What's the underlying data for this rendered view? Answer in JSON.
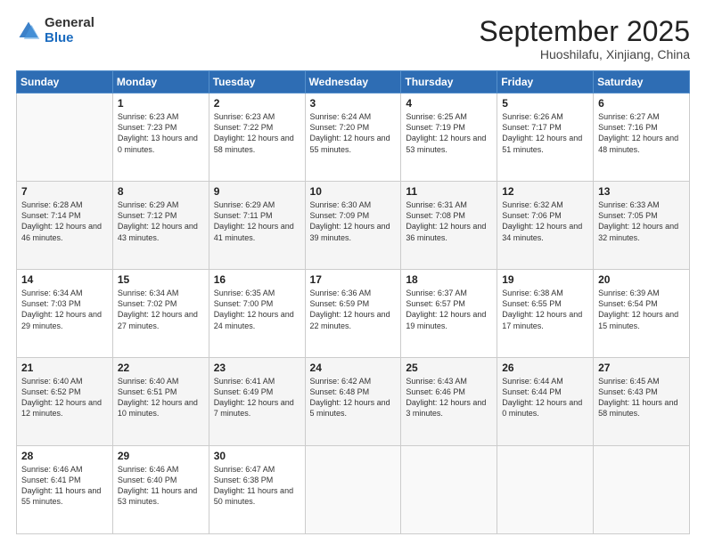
{
  "logo": {
    "general": "General",
    "blue": "Blue"
  },
  "header": {
    "month": "September 2025",
    "location": "Huoshilafu, Xinjiang, China"
  },
  "days": [
    "Sunday",
    "Monday",
    "Tuesday",
    "Wednesday",
    "Thursday",
    "Friday",
    "Saturday"
  ],
  "weeks": [
    [
      {
        "day": "",
        "sunrise": "",
        "sunset": "",
        "daylight": ""
      },
      {
        "day": "1",
        "sunrise": "Sunrise: 6:23 AM",
        "sunset": "Sunset: 7:23 PM",
        "daylight": "Daylight: 13 hours and 0 minutes."
      },
      {
        "day": "2",
        "sunrise": "Sunrise: 6:23 AM",
        "sunset": "Sunset: 7:22 PM",
        "daylight": "Daylight: 12 hours and 58 minutes."
      },
      {
        "day": "3",
        "sunrise": "Sunrise: 6:24 AM",
        "sunset": "Sunset: 7:20 PM",
        "daylight": "Daylight: 12 hours and 55 minutes."
      },
      {
        "day": "4",
        "sunrise": "Sunrise: 6:25 AM",
        "sunset": "Sunset: 7:19 PM",
        "daylight": "Daylight: 12 hours and 53 minutes."
      },
      {
        "day": "5",
        "sunrise": "Sunrise: 6:26 AM",
        "sunset": "Sunset: 7:17 PM",
        "daylight": "Daylight: 12 hours and 51 minutes."
      },
      {
        "day": "6",
        "sunrise": "Sunrise: 6:27 AM",
        "sunset": "Sunset: 7:16 PM",
        "daylight": "Daylight: 12 hours and 48 minutes."
      }
    ],
    [
      {
        "day": "7",
        "sunrise": "Sunrise: 6:28 AM",
        "sunset": "Sunset: 7:14 PM",
        "daylight": "Daylight: 12 hours and 46 minutes."
      },
      {
        "day": "8",
        "sunrise": "Sunrise: 6:29 AM",
        "sunset": "Sunset: 7:12 PM",
        "daylight": "Daylight: 12 hours and 43 minutes."
      },
      {
        "day": "9",
        "sunrise": "Sunrise: 6:29 AM",
        "sunset": "Sunset: 7:11 PM",
        "daylight": "Daylight: 12 hours and 41 minutes."
      },
      {
        "day": "10",
        "sunrise": "Sunrise: 6:30 AM",
        "sunset": "Sunset: 7:09 PM",
        "daylight": "Daylight: 12 hours and 39 minutes."
      },
      {
        "day": "11",
        "sunrise": "Sunrise: 6:31 AM",
        "sunset": "Sunset: 7:08 PM",
        "daylight": "Daylight: 12 hours and 36 minutes."
      },
      {
        "day": "12",
        "sunrise": "Sunrise: 6:32 AM",
        "sunset": "Sunset: 7:06 PM",
        "daylight": "Daylight: 12 hours and 34 minutes."
      },
      {
        "day": "13",
        "sunrise": "Sunrise: 6:33 AM",
        "sunset": "Sunset: 7:05 PM",
        "daylight": "Daylight: 12 hours and 32 minutes."
      }
    ],
    [
      {
        "day": "14",
        "sunrise": "Sunrise: 6:34 AM",
        "sunset": "Sunset: 7:03 PM",
        "daylight": "Daylight: 12 hours and 29 minutes."
      },
      {
        "day": "15",
        "sunrise": "Sunrise: 6:34 AM",
        "sunset": "Sunset: 7:02 PM",
        "daylight": "Daylight: 12 hours and 27 minutes."
      },
      {
        "day": "16",
        "sunrise": "Sunrise: 6:35 AM",
        "sunset": "Sunset: 7:00 PM",
        "daylight": "Daylight: 12 hours and 24 minutes."
      },
      {
        "day": "17",
        "sunrise": "Sunrise: 6:36 AM",
        "sunset": "Sunset: 6:59 PM",
        "daylight": "Daylight: 12 hours and 22 minutes."
      },
      {
        "day": "18",
        "sunrise": "Sunrise: 6:37 AM",
        "sunset": "Sunset: 6:57 PM",
        "daylight": "Daylight: 12 hours and 19 minutes."
      },
      {
        "day": "19",
        "sunrise": "Sunrise: 6:38 AM",
        "sunset": "Sunset: 6:55 PM",
        "daylight": "Daylight: 12 hours and 17 minutes."
      },
      {
        "day": "20",
        "sunrise": "Sunrise: 6:39 AM",
        "sunset": "Sunset: 6:54 PM",
        "daylight": "Daylight: 12 hours and 15 minutes."
      }
    ],
    [
      {
        "day": "21",
        "sunrise": "Sunrise: 6:40 AM",
        "sunset": "Sunset: 6:52 PM",
        "daylight": "Daylight: 12 hours and 12 minutes."
      },
      {
        "day": "22",
        "sunrise": "Sunrise: 6:40 AM",
        "sunset": "Sunset: 6:51 PM",
        "daylight": "Daylight: 12 hours and 10 minutes."
      },
      {
        "day": "23",
        "sunrise": "Sunrise: 6:41 AM",
        "sunset": "Sunset: 6:49 PM",
        "daylight": "Daylight: 12 hours and 7 minutes."
      },
      {
        "day": "24",
        "sunrise": "Sunrise: 6:42 AM",
        "sunset": "Sunset: 6:48 PM",
        "daylight": "Daylight: 12 hours and 5 minutes."
      },
      {
        "day": "25",
        "sunrise": "Sunrise: 6:43 AM",
        "sunset": "Sunset: 6:46 PM",
        "daylight": "Daylight: 12 hours and 3 minutes."
      },
      {
        "day": "26",
        "sunrise": "Sunrise: 6:44 AM",
        "sunset": "Sunset: 6:44 PM",
        "daylight": "Daylight: 12 hours and 0 minutes."
      },
      {
        "day": "27",
        "sunrise": "Sunrise: 6:45 AM",
        "sunset": "Sunset: 6:43 PM",
        "daylight": "Daylight: 11 hours and 58 minutes."
      }
    ],
    [
      {
        "day": "28",
        "sunrise": "Sunrise: 6:46 AM",
        "sunset": "Sunset: 6:41 PM",
        "daylight": "Daylight: 11 hours and 55 minutes."
      },
      {
        "day": "29",
        "sunrise": "Sunrise: 6:46 AM",
        "sunset": "Sunset: 6:40 PM",
        "daylight": "Daylight: 11 hours and 53 minutes."
      },
      {
        "day": "30",
        "sunrise": "Sunrise: 6:47 AM",
        "sunset": "Sunset: 6:38 PM",
        "daylight": "Daylight: 11 hours and 50 minutes."
      },
      {
        "day": "",
        "sunrise": "",
        "sunset": "",
        "daylight": ""
      },
      {
        "day": "",
        "sunrise": "",
        "sunset": "",
        "daylight": ""
      },
      {
        "day": "",
        "sunrise": "",
        "sunset": "",
        "daylight": ""
      },
      {
        "day": "",
        "sunrise": "",
        "sunset": "",
        "daylight": ""
      }
    ]
  ]
}
